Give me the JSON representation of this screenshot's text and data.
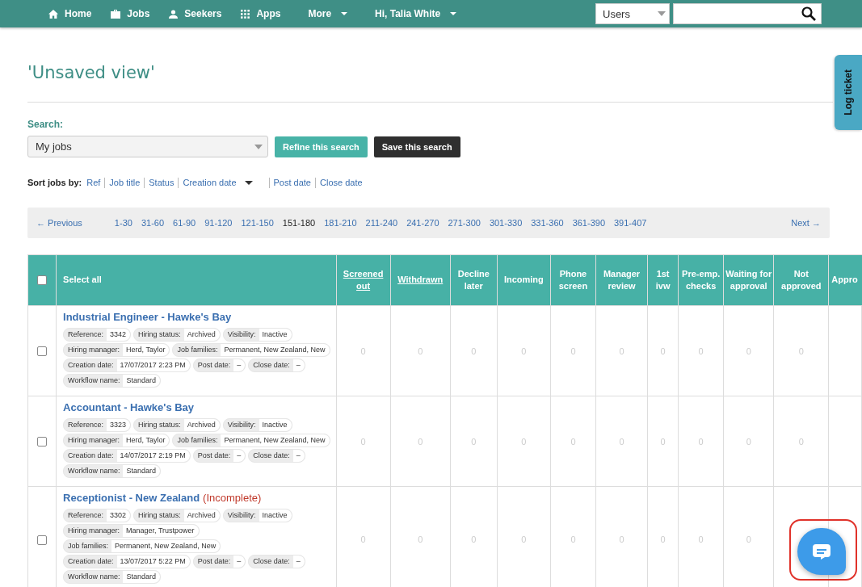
{
  "nav": {
    "items": [
      {
        "label": "Home",
        "kind": "link"
      },
      {
        "label": "Jobs",
        "kind": "link"
      },
      {
        "label": "Seekers",
        "kind": "link"
      },
      {
        "label": "Apps",
        "kind": "link"
      },
      {
        "label": "More",
        "kind": "menu"
      },
      {
        "label": "Hi, Talia White",
        "kind": "menu"
      }
    ],
    "scope": "Users"
  },
  "title": "'Unsaved view'",
  "search": {
    "label": "Search:",
    "value": "My jobs",
    "refine": "Refine this search",
    "save": "Save this search"
  },
  "sort": {
    "label": "Sort jobs by:",
    "options": [
      {
        "label": "Ref",
        "selected": false
      },
      {
        "label": "Job title",
        "selected": false
      },
      {
        "label": "Status",
        "selected": false
      },
      {
        "label": "Creation date",
        "selected": true
      },
      {
        "label": "Post date",
        "selected": false
      },
      {
        "label": "Close date",
        "selected": false
      }
    ]
  },
  "pagination": {
    "previous": "← Previous",
    "next": "Next →",
    "pages": [
      {
        "label": "1-30",
        "selected": false
      },
      {
        "label": "31-60",
        "selected": false
      },
      {
        "label": "61-90",
        "selected": false
      },
      {
        "label": "91-120",
        "selected": false
      },
      {
        "label": "121-150",
        "selected": false
      },
      {
        "label": "151-180",
        "selected": true
      },
      {
        "label": "181-210",
        "selected": false
      },
      {
        "label": "211-240",
        "selected": false
      },
      {
        "label": "241-270",
        "selected": false
      },
      {
        "label": "271-300",
        "selected": false
      },
      {
        "label": "301-330",
        "selected": false
      },
      {
        "label": "331-360",
        "selected": false
      },
      {
        "label": "361-390",
        "selected": false
      },
      {
        "label": "391-407",
        "selected": false
      }
    ]
  },
  "table": {
    "select_all": "Select all",
    "select_all_checked": false,
    "columns": [
      {
        "label": "Screened out",
        "link": true
      },
      {
        "label": "Withdrawn",
        "link": true
      },
      {
        "label": "Decline later",
        "link": false
      },
      {
        "label": "Incoming",
        "link": false
      },
      {
        "label": "Phone screen",
        "link": false
      },
      {
        "label": "Manager review",
        "link": false
      },
      {
        "label": "1st ivw",
        "link": false
      },
      {
        "label": "Pre-emp. checks",
        "link": false
      },
      {
        "label": "Waiting for approval",
        "link": false
      },
      {
        "label": "Not approved",
        "link": false
      },
      {
        "label": "Appro",
        "link": false
      }
    ],
    "rows": [
      {
        "title": "Industrial Engineer - Hawke's Bay",
        "flag": "",
        "checked": false,
        "lines": [
          [
            {
              "label": "Reference:",
              "value": "3342"
            },
            {
              "label": "Hiring status:",
              "value": "Archived"
            },
            {
              "label": "Visibility:",
              "value": "Inactive"
            }
          ],
          [
            {
              "label": "Hiring manager:",
              "value": "Herd, Taylor"
            },
            {
              "label": "Job families:",
              "value": "Permanent, New Zealand, New"
            }
          ],
          [
            {
              "label": "Creation date:",
              "value": "17/07/2017 2:23 PM"
            },
            {
              "label": "Post date:",
              "value": "–"
            },
            {
              "label": "Close date:",
              "value": "–"
            }
          ],
          [
            {
              "label": "Workflow name:",
              "value": "Standard"
            }
          ]
        ],
        "counts": [
          "0",
          "0",
          "0",
          "0",
          "0",
          "0",
          "0",
          "0",
          "0",
          "0"
        ]
      },
      {
        "title": "Accountant - Hawke's Bay",
        "flag": "",
        "checked": false,
        "lines": [
          [
            {
              "label": "Reference:",
              "value": "3323"
            },
            {
              "label": "Hiring status:",
              "value": "Archived"
            },
            {
              "label": "Visibility:",
              "value": "Inactive"
            }
          ],
          [
            {
              "label": "Hiring manager:",
              "value": "Herd, Taylor"
            },
            {
              "label": "Job families:",
              "value": "Permanent, New Zealand, New"
            }
          ],
          [
            {
              "label": "Creation date:",
              "value": "14/07/2017 2:19 PM"
            },
            {
              "label": "Post date:",
              "value": "–"
            },
            {
              "label": "Close date:",
              "value": "–"
            }
          ],
          [
            {
              "label": "Workflow name:",
              "value": "Standard"
            }
          ]
        ],
        "counts": [
          "0",
          "0",
          "0",
          "0",
          "0",
          "0",
          "0",
          "0",
          "0",
          "0"
        ]
      },
      {
        "title": "Receptionist - New Zealand",
        "flag": "(Incomplete)",
        "checked": false,
        "lines": [
          [
            {
              "label": "Reference:",
              "value": "3302"
            },
            {
              "label": "Hiring status:",
              "value": "Archived"
            },
            {
              "label": "Visibility:",
              "value": "Inactive"
            }
          ],
          [
            {
              "label": "Hiring manager:",
              "value": "Manager, Trustpower"
            }
          ],
          [
            {
              "label": "Job families:",
              "value": "Permanent, New Zealand, New"
            }
          ],
          [
            {
              "label": "Creation date:",
              "value": "13/07/2017 5:22 PM"
            },
            {
              "label": "Post date:",
              "value": "–"
            },
            {
              "label": "Close date:",
              "value": "–"
            }
          ],
          [
            {
              "label": "Workflow name:",
              "value": "Standard"
            }
          ]
        ],
        "counts": [
          "0",
          "0",
          "0",
          "0",
          "0",
          "0",
          "0",
          "0",
          "0"
        ]
      }
    ]
  },
  "log_ticket": "Log ticket"
}
